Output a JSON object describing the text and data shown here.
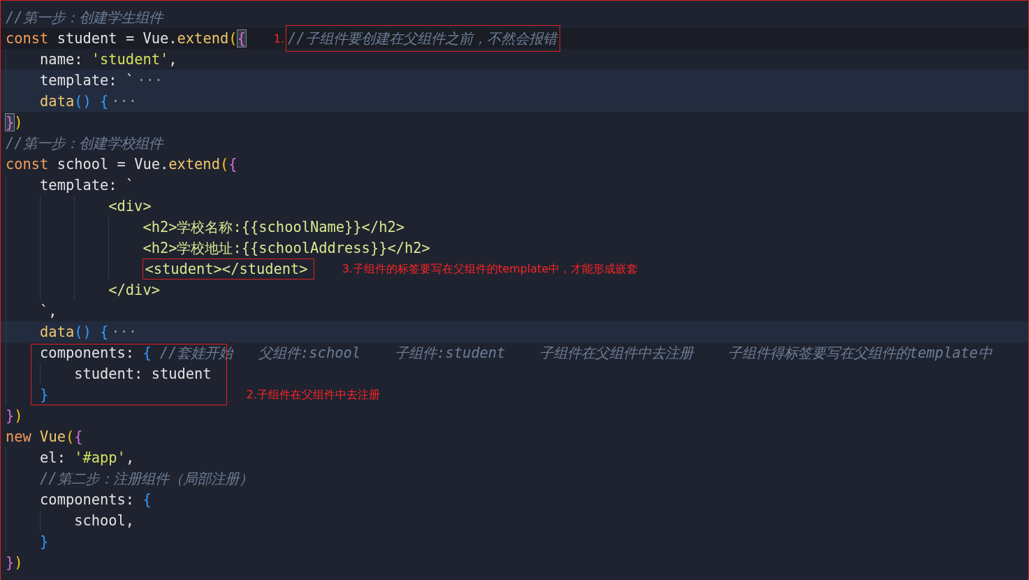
{
  "editor": {
    "lines": [
      {
        "kind": "normal",
        "boxed": false,
        "tokens": [
          {
            "text": "//第一步：创建学生组件",
            "kind": "comment"
          }
        ]
      },
      {
        "kind": "current",
        "boxed": false,
        "tokens": [
          {
            "text": "const",
            "kind": "keyword"
          },
          {
            "text": " student = Vue.",
            "kind": "plain"
          },
          {
            "text": "extend",
            "kind": "func"
          },
          {
            "text": "(",
            "kind": "b1"
          },
          {
            "text": "{",
            "kind": "matched2"
          },
          {
            "text": "1.",
            "kind": "note"
          },
          {
            "text": "//子组件要创建在父组件之前，不然会报错",
            "kind": "boxedcomment"
          }
        ]
      },
      {
        "kind": "normal",
        "boxed": false,
        "tokens": [
          {
            "text": "    name: ",
            "kind": "plain"
          },
          {
            "text": "'student'",
            "kind": "string"
          },
          {
            "text": ",",
            "kind": "plain"
          }
        ]
      },
      {
        "kind": "highlighted",
        "boxed": false,
        "tokens": [
          {
            "text": "    template: `",
            "kind": "plain"
          },
          {
            "text": "···",
            "kind": "fold"
          }
        ]
      },
      {
        "kind": "highlighted",
        "boxed": false,
        "tokens": [
          {
            "text": "    data",
            "kind": "func"
          },
          {
            "text": "() {",
            "kind": "b3"
          },
          {
            "text": "···",
            "kind": "fold"
          }
        ]
      },
      {
        "kind": "normal",
        "boxed": false,
        "tokens": [
          {
            "text": "}",
            "kind": "matched2"
          },
          {
            "text": ")",
            "kind": "b1"
          }
        ]
      },
      {
        "kind": "normal",
        "boxed": false,
        "tokens": [
          {
            "text": "//第一步：创建学校组件",
            "kind": "comment"
          }
        ]
      },
      {
        "kind": "normal",
        "boxed": false,
        "tokens": [
          {
            "text": "const",
            "kind": "keyword"
          },
          {
            "text": " school = Vue.",
            "kind": "plain"
          },
          {
            "text": "extend",
            "kind": "func"
          },
          {
            "text": "(",
            "kind": "b1"
          },
          {
            "text": "{",
            "kind": "b2"
          }
        ]
      },
      {
        "kind": "normal",
        "boxed": false,
        "tokens": [
          {
            "text": "    template: `",
            "kind": "plain"
          }
        ]
      },
      {
        "kind": "normal",
        "boxed": false,
        "tokens": [
          {
            "text": "            <div>",
            "kind": "template"
          }
        ]
      },
      {
        "kind": "normal",
        "boxed": false,
        "tokens": [
          {
            "text": "                <h2>学校名称:{{schoolName}}</h2>",
            "kind": "template"
          }
        ]
      },
      {
        "kind": "normal",
        "boxed": false,
        "tokens": [
          {
            "text": "                <h2>学校地址:{{schoolAddress}}</h2>",
            "kind": "template"
          }
        ]
      },
      {
        "kind": "normal",
        "boxed": false,
        "tokens": [
          {
            "text": "                <student></student>",
            "kind": "boxedtemplate"
          },
          {
            "text": "3.子组件的标签要写在父组件的template中，才能形成嵌套",
            "kind": "note"
          }
        ]
      },
      {
        "kind": "normal",
        "boxed": false,
        "tokens": [
          {
            "text": "            </div>",
            "kind": "template"
          }
        ]
      },
      {
        "kind": "normal",
        "boxed": false,
        "tokens": [
          {
            "text": "    `,",
            "kind": "plain"
          }
        ]
      },
      {
        "kind": "highlighted",
        "boxed": false,
        "tokens": [
          {
            "text": "    data",
            "kind": "func"
          },
          {
            "text": "() {",
            "kind": "b3"
          },
          {
            "text": "···",
            "kind": "fold"
          }
        ]
      },
      {
        "kind": "normal",
        "boxed": true,
        "tokens": [
          {
            "text": "    components: ",
            "kind": "plain"
          },
          {
            "text": "{",
            "kind": "b3"
          },
          {
            "text": "//套娃开始   父组件:school    子组件:student    子组件在父组件中去注册    子组件得标签要写在父组件的template中",
            "kind": "comment"
          }
        ]
      },
      {
        "kind": "normal",
        "boxed": true,
        "tokens": [
          {
            "text": "        student: student",
            "kind": "plain"
          }
        ]
      },
      {
        "kind": "normal",
        "boxed": true,
        "tokens": [
          {
            "text": "    }",
            "kind": "b3"
          },
          {
            "text": "2.子组件在父组件中去注册",
            "kind": "note"
          }
        ]
      },
      {
        "kind": "normal",
        "boxed": false,
        "tokens": [
          {
            "text": "}",
            "kind": "b2"
          },
          {
            "text": ")",
            "kind": "b1"
          }
        ]
      },
      {
        "kind": "normal",
        "boxed": false,
        "tokens": [
          {
            "text": "new ",
            "kind": "keyword"
          },
          {
            "text": "Vue",
            "kind": "func"
          },
          {
            "text": "(",
            "kind": "b1"
          },
          {
            "text": "{",
            "kind": "b2"
          }
        ]
      },
      {
        "kind": "normal",
        "boxed": false,
        "tokens": [
          {
            "text": "    el: ",
            "kind": "plain"
          },
          {
            "text": "'#app'",
            "kind": "string"
          },
          {
            "text": ",",
            "kind": "plain"
          }
        ]
      },
      {
        "kind": "normal",
        "boxed": false,
        "tokens": [
          {
            "text": "    //第二步：注册组件（局部注册）",
            "kind": "comment"
          }
        ]
      },
      {
        "kind": "normal",
        "boxed": false,
        "tokens": [
          {
            "text": "    components: ",
            "kind": "plain"
          },
          {
            "text": "{",
            "kind": "b3"
          }
        ]
      },
      {
        "kind": "normal",
        "boxed": false,
        "tokens": [
          {
            "text": "        school,",
            "kind": "plain"
          }
        ]
      },
      {
        "kind": "normal",
        "boxed": false,
        "tokens": [
          {
            "text": "    }",
            "kind": "b3"
          }
        ]
      },
      {
        "kind": "normal",
        "boxed": false,
        "tokens": [
          {
            "text": "}",
            "kind": "b2"
          },
          {
            "text": ")",
            "kind": "b1"
          }
        ]
      }
    ]
  }
}
